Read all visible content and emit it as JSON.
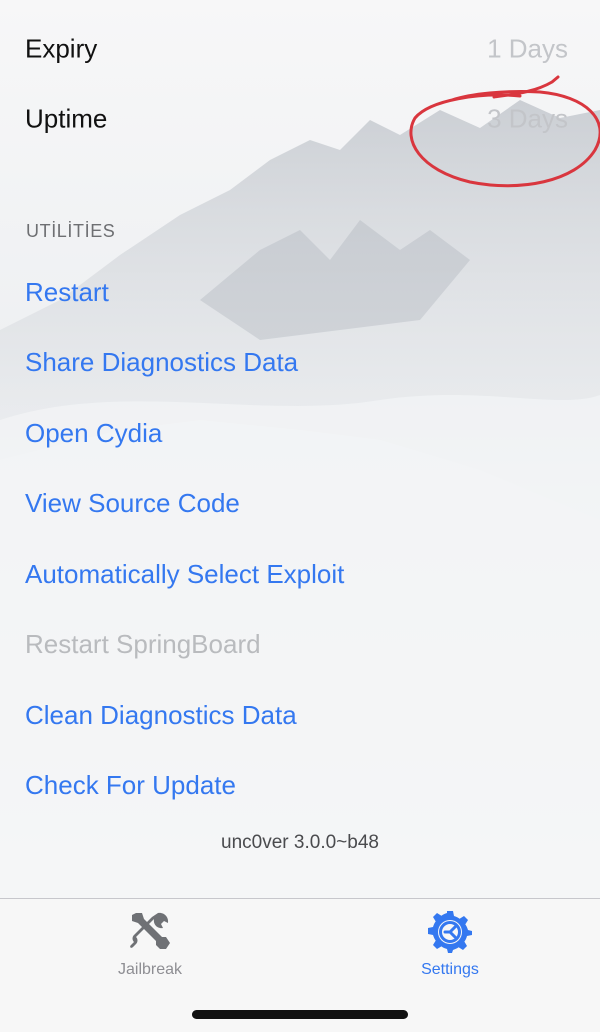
{
  "info_rows": [
    {
      "label": "Expiry",
      "value": "1 Days"
    },
    {
      "label": "Uptime",
      "value": "3 Days"
    }
  ],
  "utilities": {
    "header": "UTİLİTİES",
    "items": [
      {
        "label": "Restart",
        "enabled": true
      },
      {
        "label": "Share Diagnostics Data",
        "enabled": true
      },
      {
        "label": "Open Cydia",
        "enabled": true
      },
      {
        "label": "View Source Code",
        "enabled": true
      },
      {
        "label": "Automatically Select Exploit",
        "enabled": true
      },
      {
        "label": "Restart SpringBoard",
        "enabled": false
      },
      {
        "label": "Clean Diagnostics Data",
        "enabled": true
      },
      {
        "label": "Check For Update",
        "enabled": true
      }
    ]
  },
  "version_text": "unc0ver 3.0.0~b48",
  "tabbar": {
    "tabs": [
      {
        "label": "Jailbreak",
        "icon": "tools-icon",
        "selected": false
      },
      {
        "label": "Settings",
        "icon": "gear-icon",
        "selected": true
      }
    ]
  },
  "colors": {
    "accent": "#3478f0",
    "disabled": "#b9bbbe",
    "value_text": "#c3c5c9",
    "annotation": "#d9363e"
  },
  "icons": [
    "tools-icon",
    "gear-icon"
  ]
}
